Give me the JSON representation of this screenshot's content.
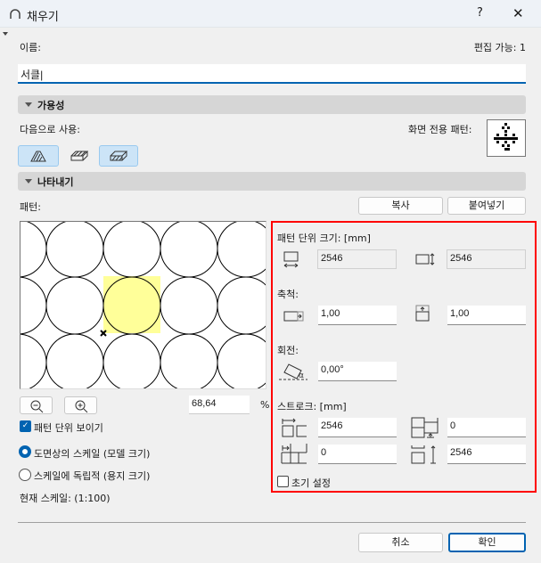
{
  "window": {
    "title": "채우기",
    "help": "?",
    "close": "✕"
  },
  "name": {
    "label": "이름:",
    "value": "서클",
    "editable": "편집 가능: 1"
  },
  "availability": {
    "header": "가용성",
    "use_as": "다음으로 사용:",
    "screen_pattern": "화면 전용 패턴:"
  },
  "appearance": {
    "header": "나타내기",
    "pattern_label": "패턴:",
    "copy": "복사",
    "paste": "붙여넣기",
    "zoom_value": "68,64",
    "zoom_unit": "%",
    "show_unit": "패턴 단위 보이기",
    "radio_model": "도면상의 스케일 (모델 크기)",
    "radio_paper": "스케일에 독립적 (용지 크기)",
    "current_scale": "현재 스케일: (1:100)"
  },
  "pattern_unit": {
    "label": "패턴 단위 크기: [mm]",
    "width": "2546",
    "height": "2546"
  },
  "scale": {
    "label": "축척:",
    "x": "1,00",
    "y": "1,00"
  },
  "rotation": {
    "label": "회전:",
    "angle": "0,00°"
  },
  "stroke": {
    "label": "스트로크: [mm]",
    "a": "2546",
    "b": "0",
    "c": "0",
    "d": "2546"
  },
  "reset": "초기 설정",
  "footer": {
    "cancel": "취소",
    "ok": "확인"
  },
  "colors": {
    "accent": "#0063b1",
    "highlight": "#ff0000",
    "unit_fill": "#ffff99"
  }
}
